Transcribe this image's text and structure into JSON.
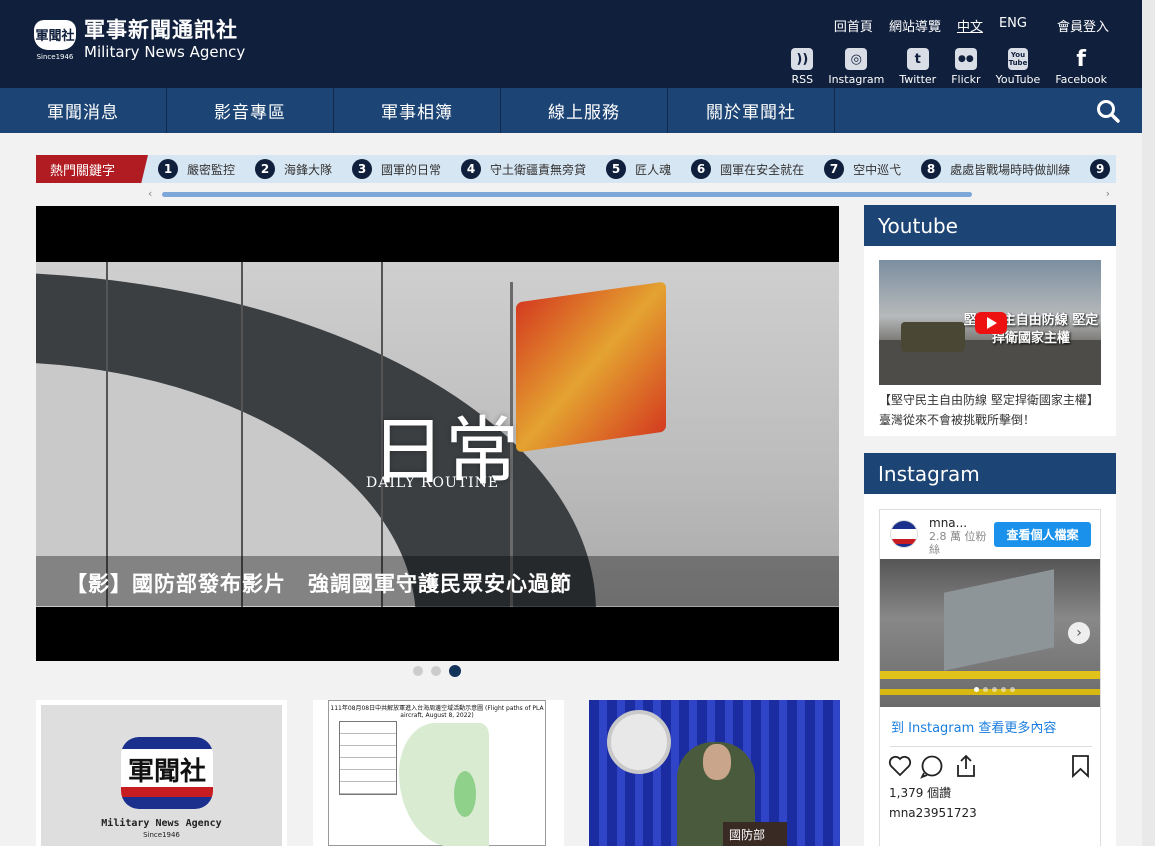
{
  "header": {
    "logo_mark": "軍聞社",
    "logo_since": "Since1946",
    "logo_zh": "軍事新聞通訊社",
    "logo_en": "Military News Agency",
    "links": [
      {
        "label": "回首頁"
      },
      {
        "label": "網站導覽"
      },
      {
        "label": "中文"
      },
      {
        "label": "ENG"
      },
      {
        "label": "會員登入"
      }
    ],
    "socials": [
      {
        "label": "RSS",
        "icon": "rss-icon",
        "glyph": "))"
      },
      {
        "label": "Instagram",
        "icon": "instagram-icon",
        "glyph": "◎"
      },
      {
        "label": "Twitter",
        "icon": "twitter-icon",
        "glyph": "t"
      },
      {
        "label": "Flickr",
        "icon": "flickr-icon",
        "glyph": "●●"
      },
      {
        "label": "YouTube",
        "icon": "youtube-icon",
        "glyph": "You Tube"
      },
      {
        "label": "Facebook",
        "icon": "facebook-icon",
        "glyph": "f"
      }
    ]
  },
  "nav": {
    "items": [
      {
        "label": "軍聞消息"
      },
      {
        "label": "影音專區"
      },
      {
        "label": "軍事相簿"
      },
      {
        "label": "線上服務"
      },
      {
        "label": "關於軍聞社"
      }
    ],
    "search_icon": "search-icon"
  },
  "hot": {
    "label": "熱門關鍵字",
    "items": [
      {
        "num": "1",
        "text": "嚴密監控"
      },
      {
        "num": "2",
        "text": "海鋒大隊"
      },
      {
        "num": "3",
        "text": "國軍的日常"
      },
      {
        "num": "4",
        "text": "守土衛疆責無旁貸"
      },
      {
        "num": "5",
        "text": "匠人魂"
      },
      {
        "num": "6",
        "text": "國軍在安全就在"
      },
      {
        "num": "7",
        "text": "空中巡弋"
      },
      {
        "num": "8",
        "text": "處處皆戰場時時做訓練"
      },
      {
        "num": "9",
        "text": ""
      }
    ]
  },
  "banner": {
    "overlay_zh": "日常",
    "overlay_en": "DAILY ROUTINE",
    "caption": "【影】國防部發布影片　強調國軍守護民眾安心過節",
    "slide_count": 3,
    "active_slide": 3
  },
  "cards": {
    "card1": {
      "mark": "軍聞社",
      "en": "Military News Agency",
      "since": "Since1946"
    },
    "card2": {
      "title": "111年08月08日中共解放軍進入台海周邊空域活動示意圖 (Flight paths of PLA aircraft, August 8, 2022)"
    },
    "card3": {
      "podium": "國防部"
    }
  },
  "youtube": {
    "heading": "Youtube",
    "thumb_text": "堅守民主自由防線 堅定捍衛國家主權",
    "desc": "【堅守民主自由防線 堅定捍衛國家主權】臺灣從來不會被挑戰所擊倒！"
  },
  "instagram": {
    "heading": "Instagram",
    "name": "mna...",
    "followers": "2.8 萬 位粉絲",
    "profile_button": "查看個人檔案",
    "more_link": "到 Instagram 查看更多內容",
    "likes": "1,379 個讚",
    "username": "mna23951723"
  },
  "colors": {
    "header_bg": "#0f1f3c",
    "nav_bg": "#1c4474",
    "hot_label_bg": "#b01c22",
    "hot_bg": "#d7e6f3",
    "ig_button": "#1a91eb"
  }
}
